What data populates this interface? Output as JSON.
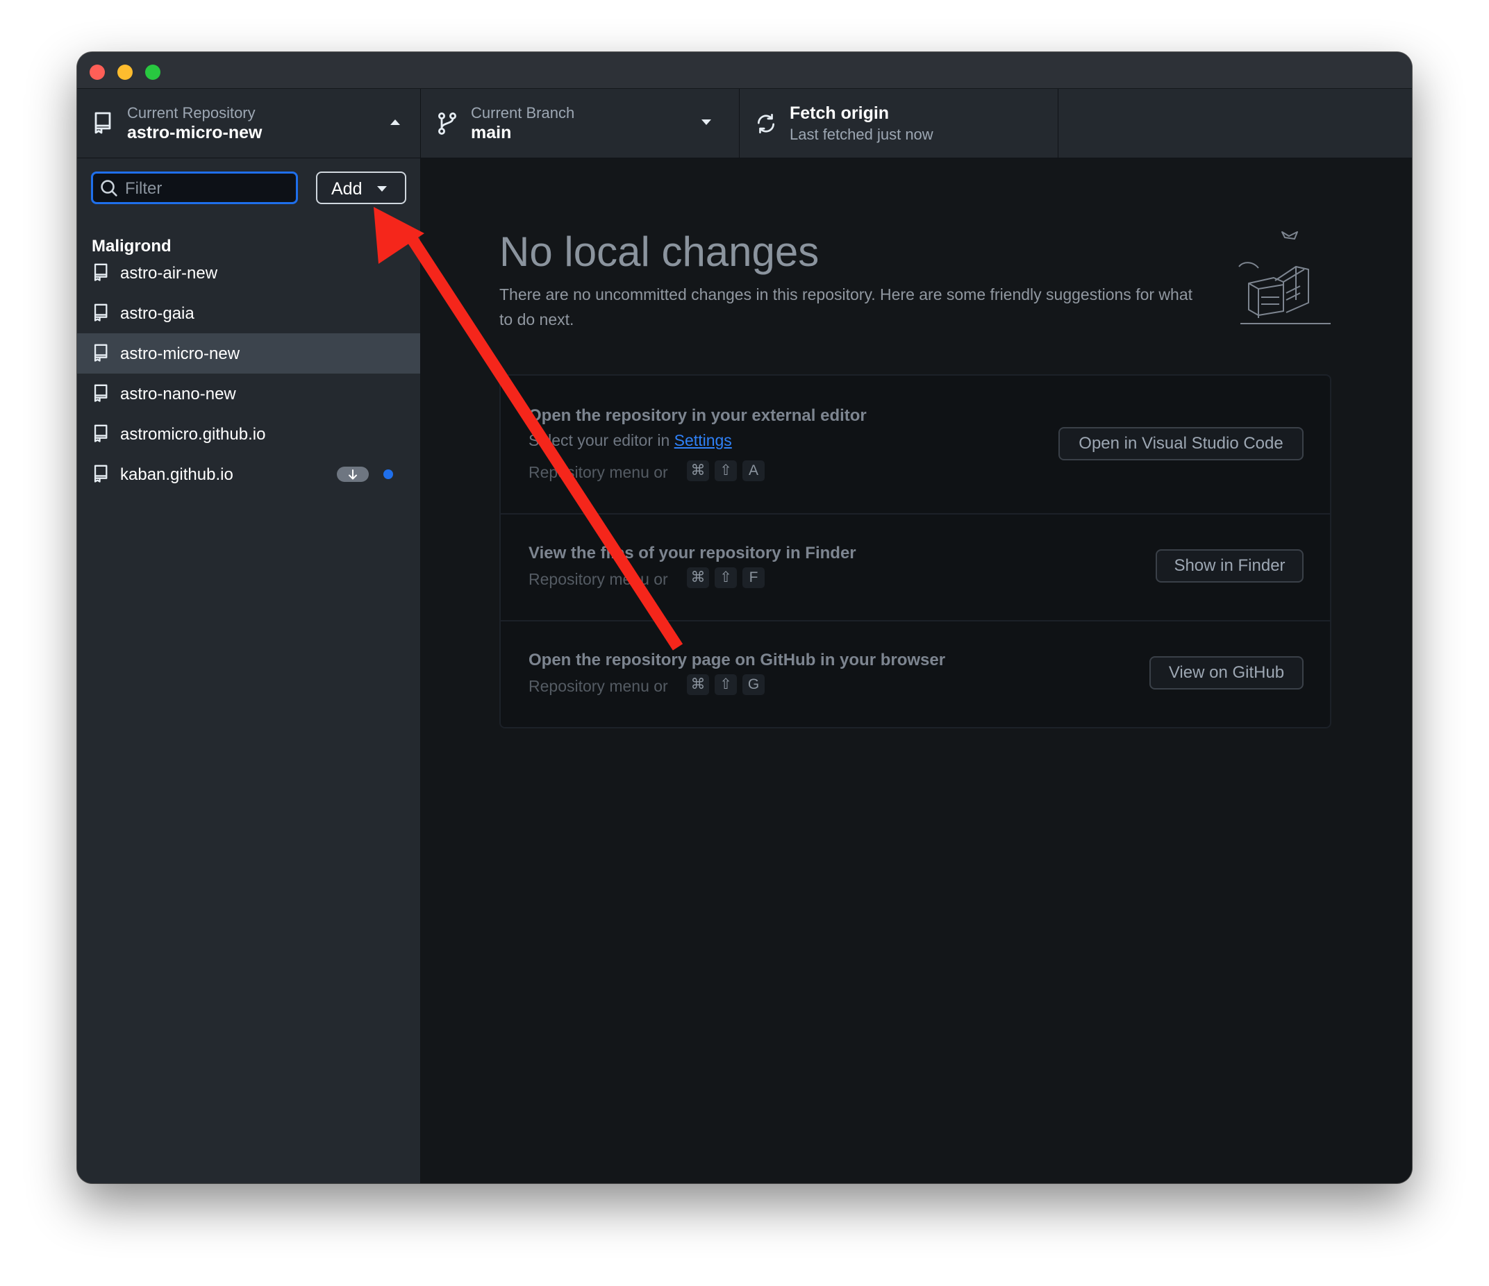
{
  "toolbar": {
    "repository": {
      "label": "Current Repository",
      "value": "astro-micro-new"
    },
    "branch": {
      "label": "Current Branch",
      "value": "main"
    },
    "fetch": {
      "label": "Fetch origin",
      "value": "Last fetched just now"
    }
  },
  "sidebar": {
    "filter_placeholder": "Filter",
    "add_label": "Add",
    "group": "Maligrond",
    "repos": [
      {
        "name": "astro-air-new"
      },
      {
        "name": "astro-gaia"
      },
      {
        "name": "astro-micro-new",
        "selected": true
      },
      {
        "name": "astro-nano-new"
      },
      {
        "name": "astromicro.github.io"
      },
      {
        "name": "kaban.github.io",
        "behind": true,
        "changes": true
      }
    ]
  },
  "main": {
    "heading": "No local changes",
    "description": "There are no uncommitted changes in this repository. Here are some friendly suggestions for what to do next.",
    "cards": [
      {
        "title": "Open the repository in your external editor",
        "subtitle_prefix": "Select your editor in ",
        "subtitle_link": "Settings",
        "shortcut_prefix": "Repository menu or",
        "keys": [
          "⌘",
          "⇧",
          "A"
        ],
        "button": "Open in Visual Studio Code"
      },
      {
        "title": "View the files of your repository in Finder",
        "shortcut_prefix": "Repository menu or",
        "keys": [
          "⌘",
          "⇧",
          "F"
        ],
        "button": "Show in Finder"
      },
      {
        "title": "Open the repository page on GitHub in your browser",
        "shortcut_prefix": "Repository menu or",
        "keys": [
          "⌘",
          "⇧",
          "G"
        ],
        "button": "View on GitHub"
      }
    ]
  },
  "colors": {
    "accent": "#1f6feb",
    "annotation_arrow": "#f5261b",
    "sidebar_bg": "#24292f",
    "main_bg": "#131619"
  }
}
